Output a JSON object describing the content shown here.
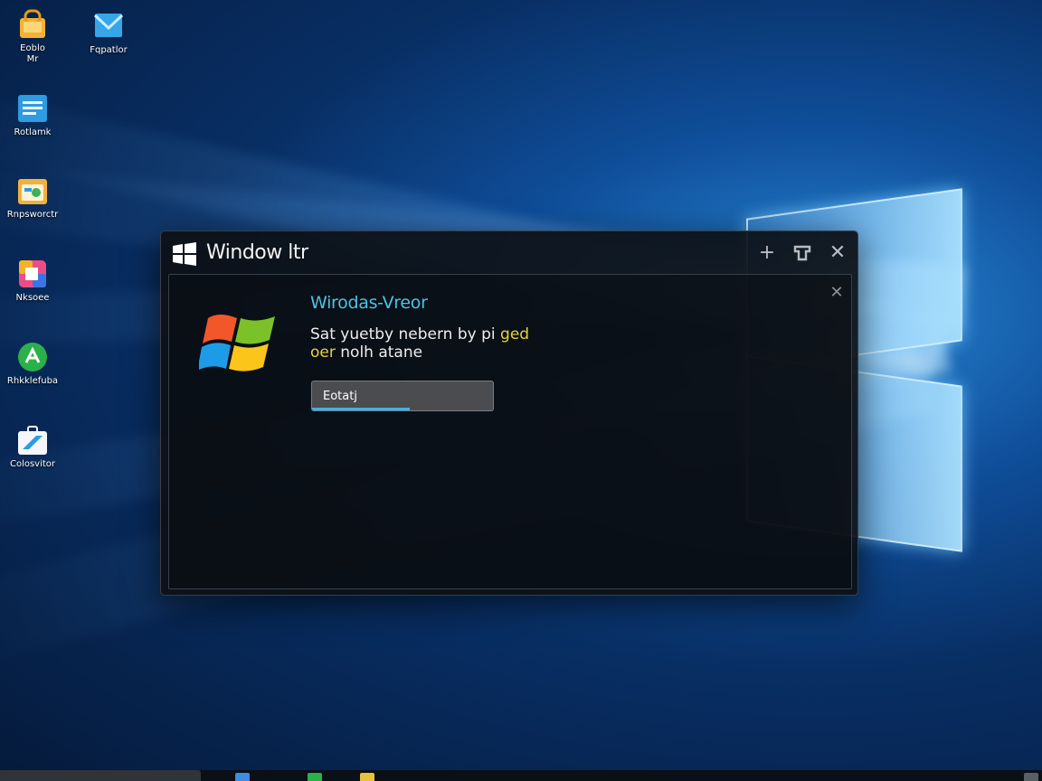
{
  "desktop": {
    "icons": [
      {
        "label": "Eoblo\nMr",
        "icon": "lock-folder-icon",
        "color": "#f2b233"
      },
      {
        "label": "Fqpatlor",
        "icon": "mail-icon",
        "color": "#37a6e8"
      },
      {
        "label": "Rotlamk",
        "icon": "document-icon",
        "color": "#2f9be0"
      },
      {
        "label": "Rnpsworctr",
        "icon": "folder-image-icon",
        "color": "#f0b23c"
      },
      {
        "label": "Nksoee",
        "icon": "colorful-app-icon",
        "color": "#e94f86"
      },
      {
        "label": "Rhkklefuba",
        "icon": "green-app-icon",
        "color": "#2bb04a"
      },
      {
        "label": "Colosvitor",
        "icon": "briefcase-icon",
        "color": "#2c9be5"
      }
    ]
  },
  "dialog": {
    "title": "Window ltr",
    "heading": "Wirodas-Vreor",
    "message_part1": "Sat yuetby nebern by pi ",
    "message_highlight1": "ged",
    "message_highlight2": "oer",
    "message_part2": " nolh atane",
    "field_value": "Eotatj",
    "progress": 0.54,
    "accent_color": "#4cc3e4",
    "highlight_color": "#e8d23c"
  }
}
